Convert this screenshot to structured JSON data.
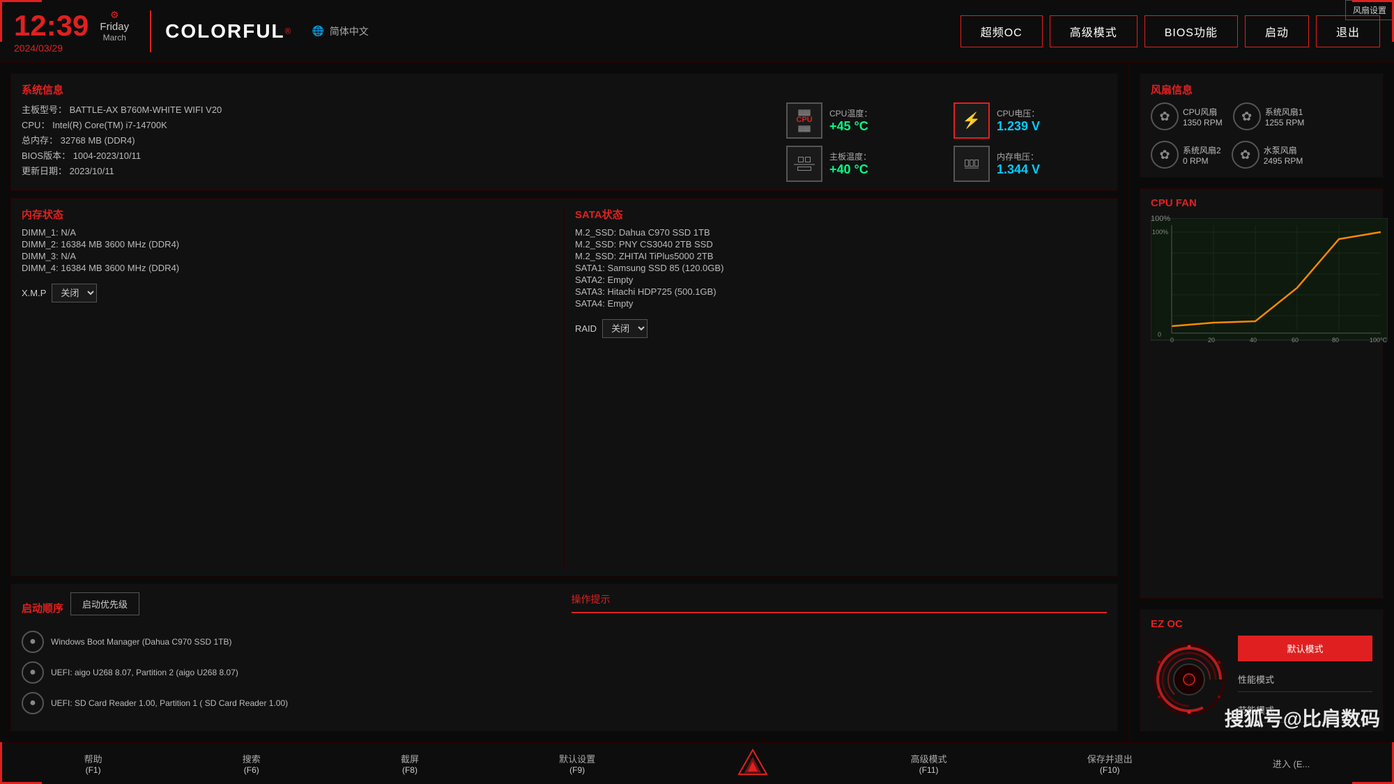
{
  "header": {
    "time": "12:39",
    "date": "2024/03/29",
    "day": "Friday",
    "month": "March",
    "brand": "COLORFUL",
    "lang_icon": "🌐",
    "lang": "简体中文",
    "nav_buttons": [
      "超频OC",
      "高级模式",
      "BIOS功能",
      "启动",
      "退出"
    ]
  },
  "system_info": {
    "title": "系统信息",
    "mb_label": "主板型号：",
    "mb_value": "BATTLE-AX B760M-WHITE WIFI V20",
    "cpu_label": "CPU：",
    "cpu_value": "Intel(R) Core(TM) i7-14700K",
    "mem_label": "总内存：",
    "mem_value": "32768 MB (DDR4)",
    "bios_label": "BIOS版本：",
    "bios_value": "1004-2023/10/11",
    "update_label": "更新日期：",
    "update_value": "2023/10/11"
  },
  "temps": {
    "cpu_temp_label": "CPU温度：",
    "cpu_temp_value": "+45 °C",
    "mb_temp_label": "主板温度：",
    "mb_temp_value": "+40 °C",
    "cpu_volt_label": "CPU电压：",
    "cpu_volt_value": "1.239 V",
    "mem_volt_label": "内存电压：",
    "mem_volt_value": "1.344 V"
  },
  "memory": {
    "title": "内存状态",
    "dimm1": "DIMM_1: N/A",
    "dimm2": "DIMM_2: 16384 MB  3600 MHz (DDR4)",
    "dimm3": "DIMM_3: N/A",
    "dimm4": "DIMM_4: 16384 MB  3600 MHz (DDR4)",
    "xmp_label": "X.M.P",
    "xmp_value": "关闭"
  },
  "sata": {
    "title": "SATA状态",
    "items": [
      "M.2_SSD: Dahua C970 SSD 1TB",
      "M.2_SSD: PNY CS3040 2TB SSD",
      "M.2_SSD: ZHITAI TiPlus5000 2TB",
      "SATA1: Samsung SSD 85 (120.0GB)",
      "SATA2: Empty",
      "SATA3: Hitachi HDP725 (500.1GB)",
      "SATA4: Empty"
    ],
    "raid_label": "RAID",
    "raid_value": "关闭"
  },
  "boot": {
    "title": "启动顺序",
    "priority_btn": "启动优先级",
    "items": [
      "Windows Boot Manager (Dahua C970 SSD 1TB)",
      "UEFI: aigo U268 8.07, Partition 2 (aigo U268 8.07)",
      "UEFI:  SD Card Reader 1.00, Partition 1 ( SD Card Reader 1.00)"
    ],
    "ops_hint_title": "操作提示"
  },
  "fan_info": {
    "title": "风扇信息",
    "fans": [
      {
        "name": "CPU风扇",
        "rpm": "1350 RPM"
      },
      {
        "name": "系统风扇1",
        "rpm": "1255 RPM"
      },
      {
        "name": "系统风扇2",
        "rpm": "0 RPM"
      },
      {
        "name": "水泵风扇",
        "rpm": "2495 RPM"
      }
    ]
  },
  "cpu_fan_chart": {
    "title": "CPU FAN",
    "y_max": "100%",
    "y_min": "0",
    "x_labels": [
      "0",
      "20",
      "40",
      "60",
      "80",
      "100°C"
    ],
    "settings_btn": "风扇设置"
  },
  "ez_oc": {
    "title": "EZ OC",
    "default_btn": "默认模式",
    "performance_label": "性能模式",
    "eco_label": "节能模式"
  },
  "bottom_bar": {
    "items": [
      {
        "label": "帮助",
        "key": "F1"
      },
      {
        "label": "搜索",
        "key": "F6"
      },
      {
        "label": "截屏",
        "key": "F8"
      },
      {
        "label": "默认设置",
        "key": "F9"
      },
      {
        "label": "高级模式",
        "key": "F11"
      },
      {
        "label": "保存并退出",
        "key": "F10"
      },
      {
        "label": "进入 (E...",
        "key": ""
      }
    ]
  },
  "watermark": "搜狐号@比肩数码"
}
